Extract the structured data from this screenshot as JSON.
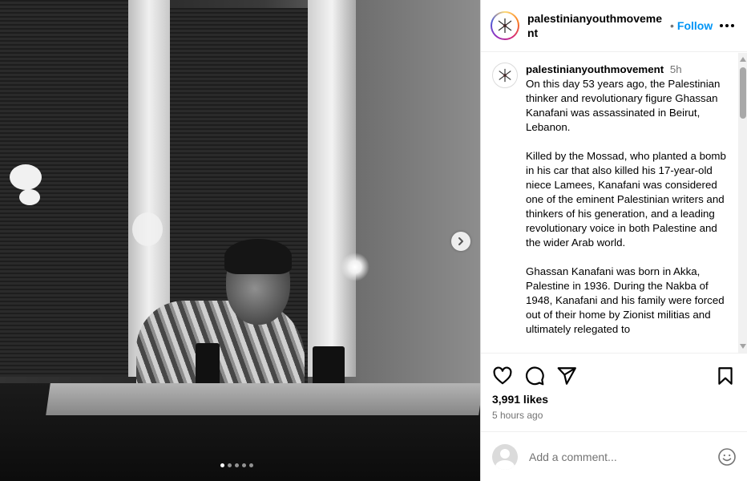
{
  "post": {
    "username": "palestinianyouthmovement",
    "follow_label": "Follow",
    "separator": "•",
    "caption_time": "5h",
    "caption_paragraphs": [
      "On this day 53 years ago, the Palestinian thinker and revolutionary figure Ghassan Kanafani was assassinated in Beirut, Lebanon.",
      "Killed by the Mossad, who planted a bomb in his car that also killed his 17-year-old niece Lamees, Kanafani was considered one of the eminent Palestinian writers and thinkers of his generation, and a leading revolutionary voice in both Palestine and the wider Arab world.",
      "Ghassan Kanafani was born in Akka, Palestine in 1936. During the Nakba of 1948, Kanafani and his family were forced out of their home by Zionist militias and ultimately relegated to"
    ],
    "likes": "3,991 likes",
    "posted_ago": "5 hours ago",
    "comment_placeholder": "Add a comment..."
  },
  "carousel": {
    "total": 5,
    "active": 0
  },
  "icons": {
    "more": "more-options-icon",
    "next": "chevron-right-icon",
    "like": "heart-icon",
    "comment": "comment-icon",
    "share": "share-icon",
    "save": "bookmark-icon",
    "emoji": "emoji-icon"
  },
  "colors": {
    "accent": "#0095f6",
    "muted": "#737373",
    "border": "#dbdbdb"
  }
}
